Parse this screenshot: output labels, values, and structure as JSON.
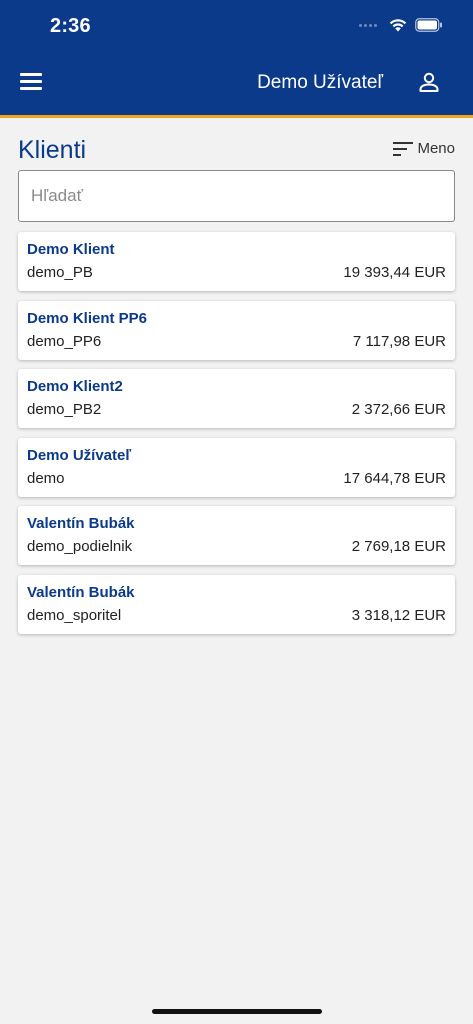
{
  "status_bar": {
    "time": "2:36"
  },
  "header": {
    "user_name": "Demo Užívateľ"
  },
  "page": {
    "title": "Klienti",
    "sort_label": "Meno"
  },
  "search": {
    "placeholder": "Hľadať",
    "value": ""
  },
  "clients": [
    {
      "name": "Demo Klient",
      "id": "demo_PB",
      "amount": "19 393,44 EUR"
    },
    {
      "name": "Demo Klient PP6",
      "id": "demo_PP6",
      "amount": "7 117,98 EUR"
    },
    {
      "name": "Demo Klient2",
      "id": "demo_PB2",
      "amount": "2 372,66 EUR"
    },
    {
      "name": "Demo Užívateľ",
      "id": "demo",
      "amount": "17 644,78 EUR"
    },
    {
      "name": "Valentín Bubák",
      "id": "demo_podielnik",
      "amount": "2 769,18 EUR"
    },
    {
      "name": "Valentín Bubák",
      "id": "demo_sporitel",
      "amount": "3 318,12 EUR"
    }
  ],
  "colors": {
    "primary": "#0b3a8a",
    "accent": "#f3a21c",
    "background": "#f2f2f2"
  },
  "icons": [
    "hamburger-menu-icon",
    "profile-icon",
    "sort-icon",
    "wifi-icon",
    "battery-icon",
    "signal-icon"
  ]
}
